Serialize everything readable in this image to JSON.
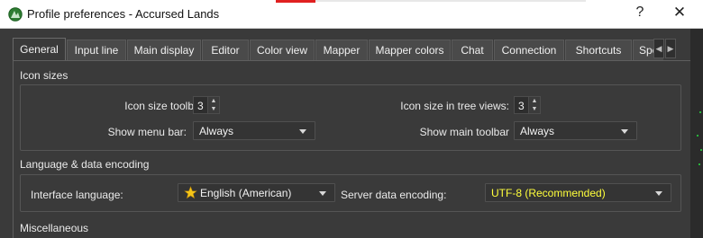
{
  "window": {
    "title": "Profile preferences - Accursed Lands",
    "help_label": "?",
    "close_label": "✕",
    "app_icon": "mudlet-icon"
  },
  "tabs": [
    {
      "label": "General",
      "active": true
    },
    {
      "label": "Input line",
      "active": false
    },
    {
      "label": "Main display",
      "active": false
    },
    {
      "label": "Editor",
      "active": false
    },
    {
      "label": "Color view",
      "active": false
    },
    {
      "label": "Mapper",
      "active": false
    },
    {
      "label": "Mapper colors",
      "active": false
    },
    {
      "label": "Chat",
      "active": false
    },
    {
      "label": "Connection",
      "active": false
    },
    {
      "label": "Shortcuts",
      "active": false
    },
    {
      "label": "Special",
      "active": false
    }
  ],
  "tab_scroll": {
    "left": "◀",
    "right": "▶"
  },
  "icon_sizes": {
    "title": "Icon sizes",
    "toolbars_label": "Icon size toolbars:",
    "toolbars_value": "3",
    "tree_label": "Icon size in tree views:",
    "tree_value": "3",
    "menu_bar_label": "Show menu bar:",
    "menu_bar_value": "Always",
    "main_toolbar_label": "Show main toolbar",
    "main_toolbar_value": "Always"
  },
  "language": {
    "title": "Language & data encoding",
    "interface_label": "Interface language:",
    "interface_value": "English (American)",
    "encoding_label": "Server data encoding:",
    "encoding_value": "UTF-8 (Recommended)"
  },
  "misc": {
    "title": "Miscellaneous"
  },
  "colors": {
    "highlight_text": "#ffff3b",
    "star": "#f5c518"
  }
}
